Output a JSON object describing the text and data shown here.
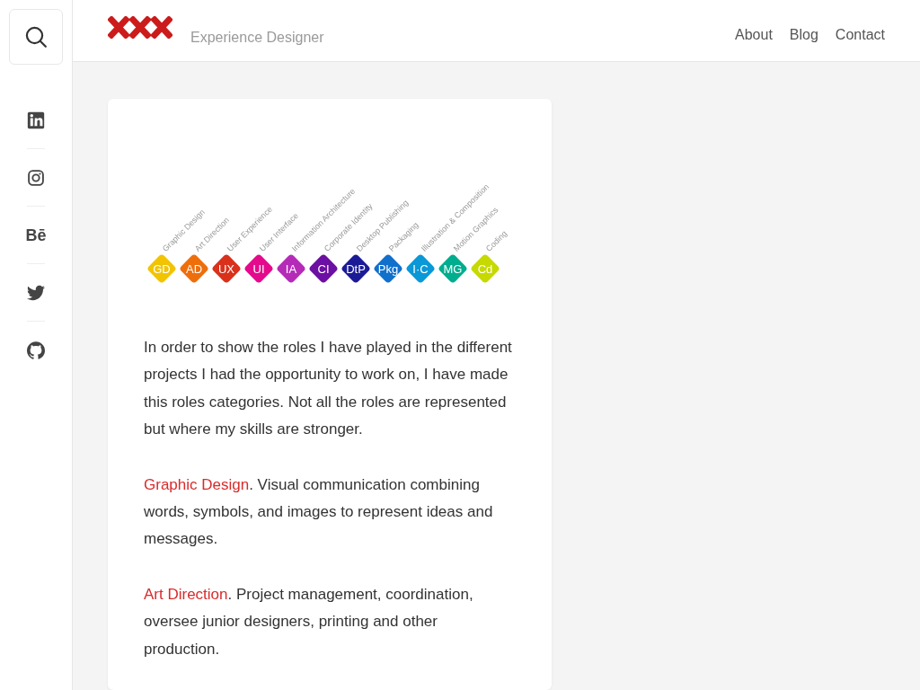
{
  "header": {
    "tagline": "Experience Designer",
    "nav": [
      "About",
      "Blog",
      "Contact"
    ]
  },
  "sidebar": {
    "social": [
      {
        "kind": "linkedin"
      },
      {
        "kind": "instagram"
      },
      {
        "kind": "behance",
        "text": "Bē"
      },
      {
        "kind": "twitter"
      },
      {
        "kind": "github"
      }
    ]
  },
  "card": {
    "roles": [
      {
        "abbr": "GD",
        "label": "Graphic Design",
        "color": "#f2c400"
      },
      {
        "abbr": "AD",
        "label": "Art Direction",
        "color": "#ee6e0c"
      },
      {
        "abbr": "UX",
        "label": "User Experience",
        "color": "#d9311b"
      },
      {
        "abbr": "UI",
        "label": "User Interface",
        "color": "#e40a8c"
      },
      {
        "abbr": "IA",
        "label": "Information Architecture",
        "color": "#b52bb8"
      },
      {
        "abbr": "CI",
        "label": "Corporate Identity",
        "color": "#6c0fa3"
      },
      {
        "abbr": "DtP",
        "label": "Desktop Publishing",
        "color": "#1b1b98"
      },
      {
        "abbr": "Pkg",
        "label": "Packaging",
        "color": "#1070cc"
      },
      {
        "abbr": "I·C",
        "label": "Illustration & Composition",
        "color": "#0a98d6"
      },
      {
        "abbr": "MG",
        "label": "Motion Graphics",
        "color": "#00ad8e"
      },
      {
        "abbr": "Cd",
        "label": "Coding",
        "color": "#c6d900"
      }
    ],
    "paragraphs": [
      {
        "text": "In order to show the roles I have played in the different projects I had the opportunity to work on, I have made this roles categories. Not all the roles are represented but where my skills are stronger."
      },
      {
        "term": "Graphic Design",
        "text": ". Visual communication combining words, symbols, and images to represent ideas and messages."
      },
      {
        "term": "Art Direction",
        "text": ". Project management, coordination, oversee junior designers, printing and other production."
      }
    ]
  }
}
